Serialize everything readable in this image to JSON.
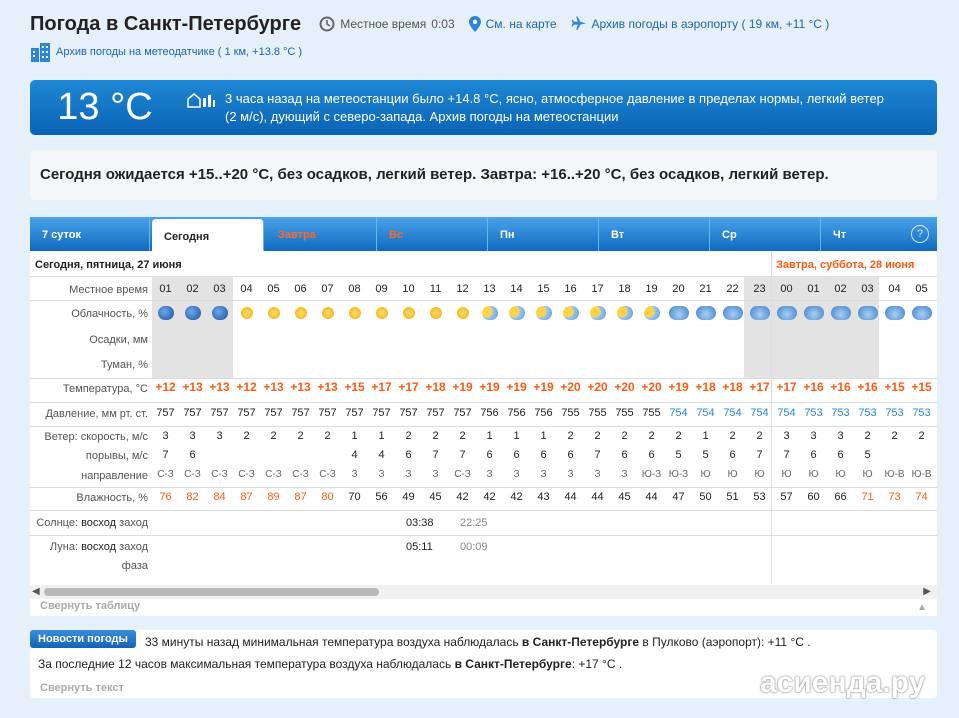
{
  "header": {
    "title": "Погода в Санкт-Петербурге",
    "local_time_label": "Местное время",
    "local_time": "0:03",
    "map_link": "См. на карте",
    "airport_link": "Архив погоды в аэропорту ( 19 км, +11 °C )",
    "sensor_link": "Архив погоды на метеодатчике ( 1 км, +13.8 °C )"
  },
  "banner": {
    "temp": "13 °C",
    "text": "3 часа назад на метеостанции было +14.8 °C, ясно, атмосферное давление в пределах нормы, легкий ветер (2 м/с), дующий с северо-запада. Архив погоды на метеостанции"
  },
  "forecast": "Сегодня ожидается +15..+20 °C, без осадков, легкий ветер. Завтра: +16..+20 °C, без осадков, легкий ветер.",
  "tabs": [
    {
      "label": "7 суток"
    },
    {
      "label": "Сегодня"
    },
    {
      "label": "Завтра"
    },
    {
      "label": "Вс"
    },
    {
      "label": "Пн"
    },
    {
      "label": "Вт"
    },
    {
      "label": "Ср"
    },
    {
      "label": "Чт"
    }
  ],
  "help": "?",
  "table": {
    "today_label": "Сегодня, пятница, 27 июня",
    "tomorrow_label": "Завтра, суббота, 28 июня",
    "labels": {
      "time": "Местное время",
      "cloud": "Облачность, %",
      "precip": "Осадки, мм",
      "fog": "Туман, %",
      "temp": "Температура, °C",
      "pressure": "Давление, мм рт. ст.",
      "wind": "Ветер: скорость, м/с",
      "gusts": "порывы, м/с",
      "direction": "направление",
      "humidity": "Влажность, %",
      "sun_prefix": "Солнце:",
      "sun_rise": "восход",
      "sun_set": "заход",
      "moon_prefix": "Луна:",
      "moon_rise": "восход",
      "moon_set": "заход",
      "phase": "фаза"
    },
    "hours": [
      "01",
      "02",
      "03",
      "04",
      "05",
      "06",
      "07",
      "08",
      "09",
      "10",
      "11",
      "12",
      "13",
      "14",
      "15",
      "16",
      "17",
      "18",
      "19",
      "20",
      "21",
      "22",
      "23",
      "00",
      "01",
      "02",
      "03",
      "04",
      "05"
    ],
    "clouds": [
      "night",
      "night",
      "night",
      "sun",
      "sun",
      "sun",
      "sun",
      "sun",
      "sun",
      "sun",
      "sun",
      "sun",
      "pc",
      "pc",
      "pc",
      "pc",
      "pc",
      "pc",
      "pc",
      "cl",
      "cl",
      "cl",
      "cl",
      "cl",
      "cl",
      "cl",
      "cl",
      "cl",
      "cl"
    ],
    "temps": [
      "+12",
      "+13",
      "+13",
      "+12",
      "+13",
      "+13",
      "+13",
      "+15",
      "+17",
      "+17",
      "+18",
      "+19",
      "+19",
      "+19",
      "+19",
      "+20",
      "+20",
      "+20",
      "+20",
      "+19",
      "+18",
      "+18",
      "+17",
      "+17",
      "+16",
      "+16",
      "+16",
      "+15",
      "+15"
    ],
    "pressure": [
      "757",
      "757",
      "757",
      "757",
      "757",
      "757",
      "757",
      "757",
      "757",
      "757",
      "757",
      "757",
      "756",
      "756",
      "756",
      "755",
      "755",
      "755",
      "755",
      "754",
      "754",
      "754",
      "754",
      "754",
      "753",
      "753",
      "753",
      "753",
      "753"
    ],
    "wind": [
      "3",
      "3",
      "3",
      "2",
      "2",
      "2",
      "2",
      "1",
      "1",
      "2",
      "2",
      "2",
      "1",
      "1",
      "1",
      "2",
      "2",
      "2",
      "2",
      "2",
      "1",
      "2",
      "2",
      "3",
      "3",
      "3",
      "2",
      "2",
      "2"
    ],
    "gusts": [
      "7",
      "6",
      "",
      "",
      "",
      "",
      "",
      "4",
      "4",
      "6",
      "7",
      "7",
      "6",
      "6",
      "6",
      "6",
      "7",
      "6",
      "6",
      "5",
      "5",
      "6",
      "7",
      "7",
      "6",
      "6",
      "5",
      "",
      ""
    ],
    "dirs": [
      "С-З",
      "С-З",
      "С-З",
      "С-З",
      "С-З",
      "С-З",
      "С-З",
      "З",
      "З",
      "З",
      "З",
      "С-З",
      "З",
      "З",
      "З",
      "З",
      "З",
      "З",
      "Ю-З",
      "Ю-З",
      "Ю",
      "Ю",
      "Ю",
      "Ю",
      "Ю",
      "Ю",
      "Ю",
      "Ю-В",
      "Ю-В"
    ],
    "humidity": [
      "76",
      "82",
      "84",
      "87",
      "89",
      "87",
      "80",
      "70",
      "56",
      "49",
      "45",
      "42",
      "42",
      "42",
      "43",
      "44",
      "44",
      "45",
      "44",
      "47",
      "50",
      "51",
      "53",
      "57",
      "60",
      "66",
      "71",
      "73",
      "74"
    ],
    "sunrise": "03:38",
    "sunset": "22:25",
    "moonrise": "05:11",
    "moonset": "00:09",
    "collapse": "Свернуть таблицу"
  },
  "news": {
    "button": "Новости погоды",
    "line1_a": "33 минуты назад минимальная температура воздуха наблюдалась ",
    "line1_b": "в Санкт-Петербурге",
    "line1_c": " в Пулково (аэропорт): +11 ",
    "line1_d": "°C .",
    "line2_a": "За последние 12 часов максимальная температура воздуха наблюдалась ",
    "line2_b": "в Санкт-Петербурге",
    "line2_c": ": +17 ",
    "line2_d": "°C .",
    "collapse": "Свернуть текст"
  },
  "watermark": "асиенда.ру",
  "colors": {
    "accent": "#0f6ac0",
    "warm": "#ff5a10",
    "link": "#2066a8"
  }
}
